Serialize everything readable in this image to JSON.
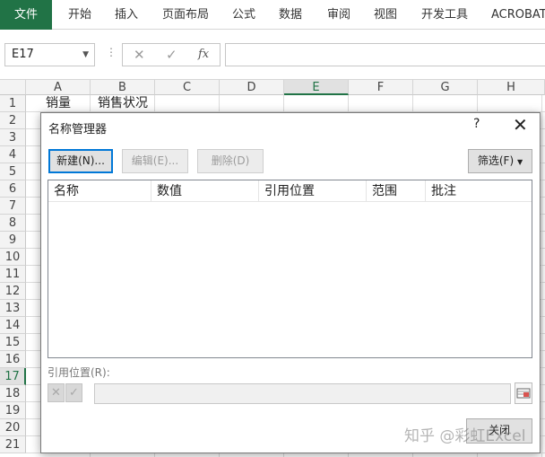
{
  "ribbon": {
    "tabs": [
      {
        "label": "文件"
      },
      {
        "label": "开始"
      },
      {
        "label": "插入"
      },
      {
        "label": "页面布局"
      },
      {
        "label": "公式"
      },
      {
        "label": "数据"
      },
      {
        "label": "审阅"
      },
      {
        "label": "视图"
      },
      {
        "label": "开发工具"
      },
      {
        "label": "ACROBAT"
      }
    ]
  },
  "formula_bar": {
    "name_box": "E17",
    "cancel_icon": "✕",
    "enter_icon": "✓",
    "fx_icon": "fx",
    "formula": ""
  },
  "sheet": {
    "columns": [
      "A",
      "B",
      "C",
      "D",
      "E",
      "F",
      "G",
      "H"
    ],
    "rows": [
      "1",
      "2",
      "3",
      "4",
      "5",
      "6",
      "7",
      "8",
      "9",
      "10",
      "11",
      "12",
      "13",
      "14",
      "15",
      "16",
      "17",
      "18",
      "19",
      "20",
      "21"
    ],
    "active_column": "E",
    "active_row": "17",
    "cells": {
      "A1": "销量",
      "B1": "销售状况"
    }
  },
  "dialog": {
    "title": "名称管理器",
    "help": "?",
    "close": "✕",
    "new_button": "新建(N)...",
    "edit_button": "编辑(E)...",
    "delete_button": "删除(D)",
    "filter_button": "筛选(F)",
    "columns": [
      "名称",
      "数值",
      "引用位置",
      "范围",
      "批注"
    ],
    "ref_label": "引用位置(R):",
    "close_button": "关闭"
  },
  "watermark": "知乎 @彩虹Excel",
  "colors": {
    "excel_green": "#217346",
    "focus_blue": "#0078d7"
  }
}
